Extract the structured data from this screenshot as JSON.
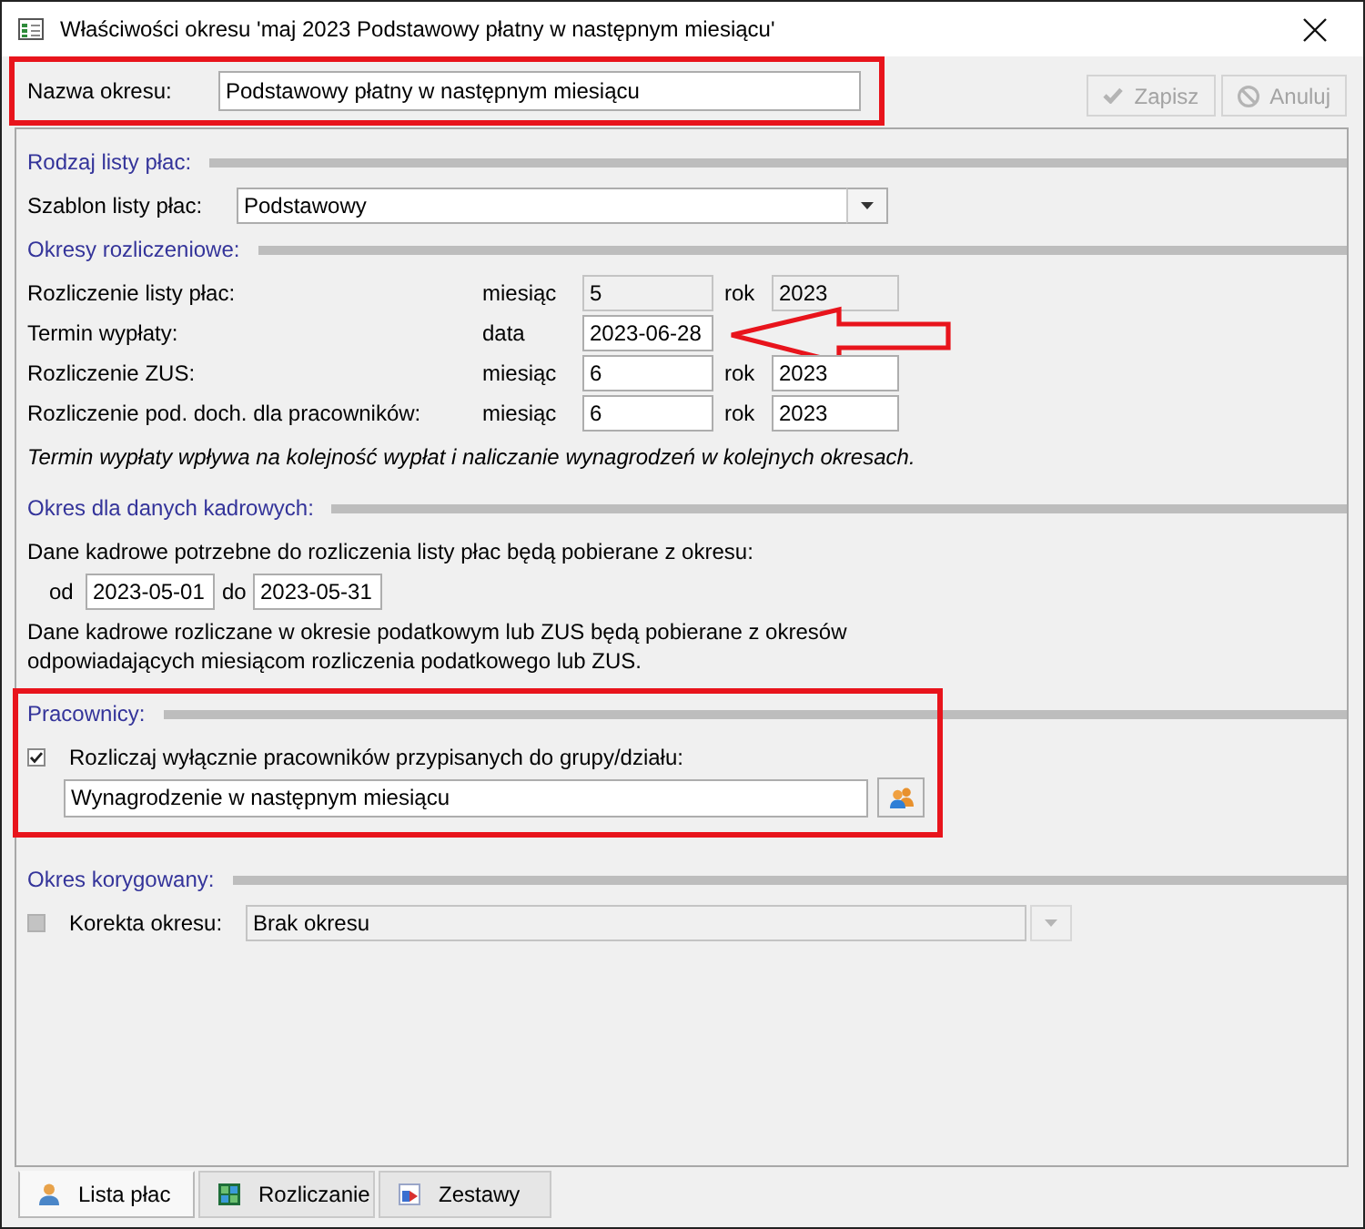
{
  "window": {
    "title": "Właściwości okresu 'maj 2023 Podstawowy płatny w następnym miesiącu'"
  },
  "name_row": {
    "label": "Nazwa okresu:",
    "value": "Podstawowy płatny w następnym miesiącu",
    "highlighted": true
  },
  "toolbar": {
    "buttons": [
      {
        "label": "Zapisz",
        "kind": "save",
        "disabled": true
      },
      {
        "label": "Anuluj",
        "kind": "cancel",
        "disabled": true
      }
    ]
  },
  "sections": [
    {
      "kind": "template",
      "heading": "Rodzaj listy płac:",
      "label": "Szablon listy płac:",
      "value": "Podstawowy"
    },
    {
      "kind": "periods",
      "heading": "Okresy rozliczeniowe:",
      "rows": [
        {
          "label": "Rozliczenie listy płac:",
          "unit": "miesiąc",
          "value": "5",
          "year_label": "rok",
          "year": "2023",
          "disabled": true,
          "pointer_arrow": false
        },
        {
          "label": "Termin wypłaty:",
          "unit": "data",
          "value": "2023-06-28",
          "disabled": false,
          "pointer_arrow": true
        },
        {
          "label": "Rozliczenie ZUS:",
          "unit": "miesiąc",
          "value": "6",
          "year_label": "rok",
          "year": "2023",
          "disabled": false,
          "pointer_arrow": false
        },
        {
          "label": "Rozliczenie pod. doch. dla pracowników:",
          "unit": "miesiąc",
          "value": "6",
          "year_label": "rok",
          "year": "2023",
          "disabled": false,
          "pointer_arrow": false
        }
      ],
      "note": "Termin wypłaty wpływa na kolejność wypłat i naliczanie wynagrodzeń w kolejnych okresach."
    },
    {
      "kind": "hr_period",
      "heading": "Okres dla danych kadrowych:",
      "intro": "Dane kadrowe potrzebne do rozliczenia listy płac będą pobierane z okresu:",
      "from_label": "od",
      "from": "2023-05-01",
      "to_label": "do",
      "to": "2023-05-31",
      "note": "Dane kadrowe rozliczane w okresie podatkowym lub ZUS będą pobierane z okresów odpowiadających miesiącom rozliczenia podatkowego lub ZUS."
    },
    {
      "kind": "employees",
      "heading": "Pracownicy:",
      "highlighted": true,
      "checkbox": {
        "label": "Rozliczaj wyłącznie pracowników przypisanych do grupy/działu:",
        "checked": true,
        "disabled": false
      },
      "group": "Wynagrodzenie w następnym miesiącu"
    },
    {
      "kind": "correction",
      "heading": "Okres korygowany:",
      "checkbox": {
        "label": "Korekta okresu:",
        "checked": false,
        "disabled": true
      },
      "value": "Brak okresu",
      "disabled": true
    }
  ],
  "tabs": [
    {
      "label": "Lista płac",
      "selected": true
    },
    {
      "label": "Rozliczanie",
      "selected": false
    },
    {
      "label": "Zestawy",
      "selected": false
    }
  ]
}
